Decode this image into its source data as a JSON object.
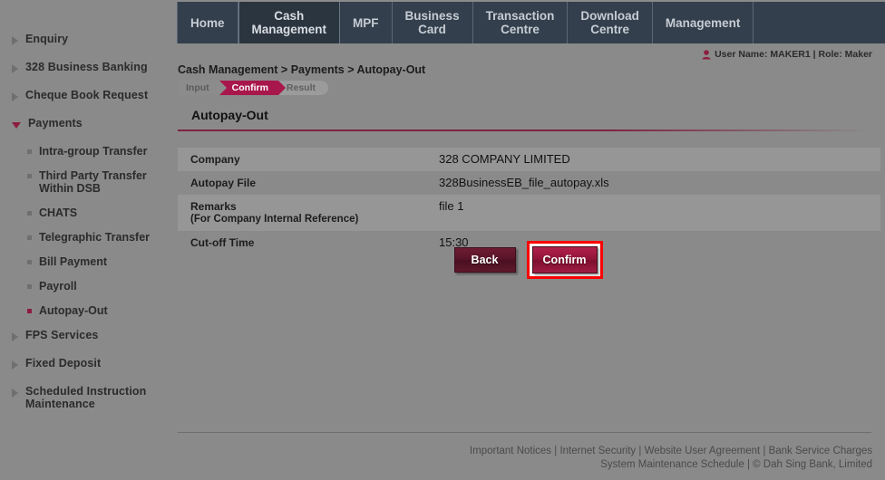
{
  "sidebar": {
    "groups": [
      {
        "label": "Enquiry",
        "expanded": false,
        "children": []
      },
      {
        "label": "328 Business Banking",
        "expanded": false,
        "children": []
      },
      {
        "label": "Cheque Book Request",
        "expanded": false,
        "children": []
      },
      {
        "label": "Payments",
        "expanded": true,
        "children": [
          {
            "label": "Intra-group Transfer",
            "active": false
          },
          {
            "label": "Third Party Transfer Within DSB",
            "active": false
          },
          {
            "label": "CHATS",
            "active": false
          },
          {
            "label": "Telegraphic Transfer",
            "active": false
          },
          {
            "label": "Bill Payment",
            "active": false
          },
          {
            "label": "Payroll",
            "active": false
          },
          {
            "label": "Autopay-Out",
            "active": true
          }
        ]
      },
      {
        "label": "FPS Services",
        "expanded": false,
        "children": []
      },
      {
        "label": "Fixed Deposit",
        "expanded": false,
        "children": []
      },
      {
        "label": "Scheduled Instruction Maintenance",
        "expanded": false,
        "children": []
      }
    ]
  },
  "topnav": {
    "tabs": [
      {
        "label": "Home",
        "active": false
      },
      {
        "label": "Cash\nManagement",
        "active": true
      },
      {
        "label": "MPF",
        "active": false
      },
      {
        "label": "Business\nCard",
        "active": false
      },
      {
        "label": "Transaction\nCentre",
        "active": false
      },
      {
        "label": "Download\nCentre",
        "active": false
      },
      {
        "label": "Management",
        "active": false
      }
    ]
  },
  "header": {
    "user_icon": "person-icon",
    "user_info": "User Name: MAKER1 | Role: Maker",
    "breadcrumb": "Cash Management > Payments > Autopay-Out",
    "steps": [
      {
        "label": "Input",
        "state": "done"
      },
      {
        "label": "Confirm",
        "state": "current"
      },
      {
        "label": "Result",
        "state": "pending"
      }
    ]
  },
  "page": {
    "title": "Autopay-Out",
    "rows": [
      {
        "label": "Company",
        "sublabel": "",
        "value": "328 COMPANY LIMITED"
      },
      {
        "label": "Autopay File",
        "sublabel": "",
        "value": "328BusinessEB_file_autopay.xls"
      },
      {
        "label": "Remarks",
        "sublabel": "(For Company Internal Reference)",
        "value": "file 1"
      },
      {
        "label": "Cut-off Time",
        "sublabel": "",
        "value": "15:30"
      }
    ],
    "buttons": {
      "back": "Back",
      "confirm": "Confirm"
    }
  },
  "footer": {
    "line1": [
      "Important Notices",
      "Internet Security",
      "Website User Agreement",
      "Bank Service Charges"
    ],
    "line2": [
      "System Maintenance Schedule",
      "© Dah Sing Bank, Limited"
    ],
    "separator": " | "
  },
  "colors": {
    "brand_maroon": "#8d1c3e",
    "step_active": "#a8174b",
    "nav_bg": "#333f4c",
    "nav_active_bg": "#2b3540",
    "page_bg": "#8a8a8a",
    "highlight_box": "#ff0000"
  }
}
